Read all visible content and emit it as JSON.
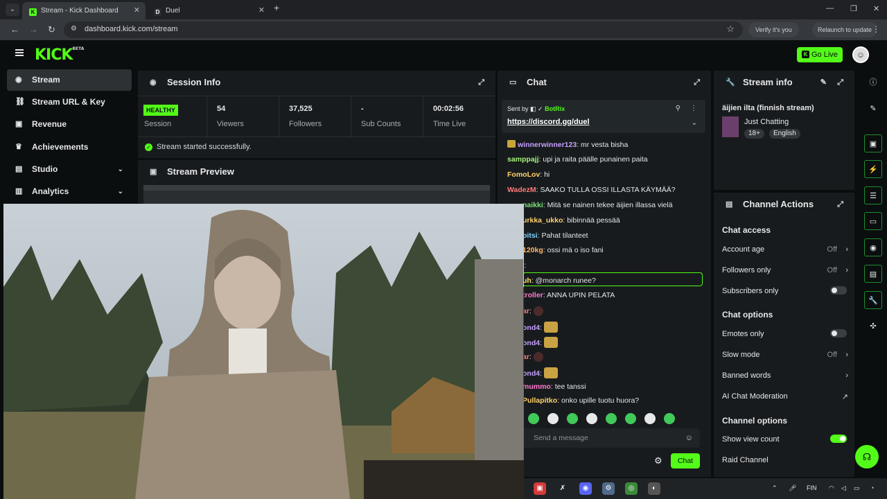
{
  "browser": {
    "tabs": [
      {
        "label": "Stream - Kick Dashboard",
        "favicon": "K"
      },
      {
        "label": "Duel",
        "favicon": "D"
      }
    ],
    "url": "dashboard.kick.com/stream",
    "verify_label": "Verify it's you",
    "relaunch_label": "Relaunch to update"
  },
  "header": {
    "logo": "KICK",
    "logo_badge": "BETA",
    "go_live_label": "Go Live",
    "brand_color": "#53fc18"
  },
  "sidebar": {
    "items": [
      {
        "label": "Stream",
        "icon": "stream-icon",
        "active": true
      },
      {
        "label": "Stream URL & Key",
        "icon": "link-icon"
      },
      {
        "label": "Revenue",
        "icon": "revenue-icon"
      },
      {
        "label": "Achievements",
        "icon": "trophy-icon"
      },
      {
        "label": "Studio",
        "icon": "studio-icon",
        "expandable": true
      },
      {
        "label": "Analytics",
        "icon": "analytics-icon",
        "expandable": true
      }
    ]
  },
  "session": {
    "title": "Session Info",
    "health_badge": "HEALTHY",
    "health_label": "Session",
    "stats": [
      {
        "value": "54",
        "label": "Viewers"
      },
      {
        "value": "37,525",
        "label": "Followers"
      },
      {
        "value": "-",
        "label": "Sub Counts"
      },
      {
        "value": "00:02:56",
        "label": "Time Live"
      }
    ],
    "success_message": "Stream started successfully."
  },
  "preview": {
    "title": "Stream Preview"
  },
  "chat": {
    "title": "Chat",
    "pinned": {
      "sent_by_label": "Sent by",
      "sender": "BotRix",
      "link": "https://discord.gg/duel"
    },
    "messages": [
      {
        "user": "winnerwinner123",
        "color": "#c6a0ff",
        "text": "mr vesta bisha",
        "badge": true
      },
      {
        "user": "samppajj",
        "color": "#a7f07a",
        "text": "upi ja raita päälle punainen paita"
      },
      {
        "user": "FomoLov",
        "color": "#ffd36b",
        "text": "hi"
      },
      {
        "user": "WadezM",
        "color": "#ff7a7a",
        "text": "SAAKO TULLA OSSI ILLASTA KÄYMÄÄ?"
      },
      {
        "user": "naikki",
        "color": "#7ee07e",
        "text": "Mitä se nainen tekee äijien illassa vielä"
      },
      {
        "user": "urkka_ukko",
        "color": "#ffcf6b",
        "text": "bibinnää pessää"
      },
      {
        "user": "pitsi",
        "color": "#7fd3ff",
        "text": "Pahat tilanteet"
      },
      {
        "user": "120kg",
        "color": "#ffb86b",
        "text": "ossi mä o iso fani"
      },
      {
        "user": "",
        "color": "#e6e8ea",
        "text": "l:"
      },
      {
        "user": "uh",
        "color": "#ffe26b",
        "text": "@monarch runee?"
      },
      {
        "user": "troller",
        "color": "#ff7ad1",
        "text": "ANNA UPIN PELATA"
      },
      {
        "user": "ar",
        "color": "#ff7a7a",
        "text": ""
      },
      {
        "user": "ond4",
        "color": "#c6a0ff",
        "text": ""
      },
      {
        "user": "ond4",
        "color": "#c6a0ff",
        "text": ""
      },
      {
        "user": "ar",
        "color": "#ff7a7a",
        "text": ""
      },
      {
        "user": "ond4",
        "color": "#c6a0ff",
        "text": ""
      },
      {
        "user": "mummo",
        "color": "#ff7ad1",
        "text": "tee tanssi"
      },
      {
        "user": "Pullapitko",
        "color": "#ffd36b",
        "text": "onko upille tuotu huora?"
      }
    ],
    "input_placeholder": "Send a message",
    "send_label": "Chat"
  },
  "stream_info": {
    "title": "Stream info",
    "stream_title": "äijien ilta (finnish stream)",
    "category": "Just Chatting",
    "tags": [
      "18+",
      "English"
    ]
  },
  "channel_actions": {
    "title": "Channel Actions",
    "chat_access": {
      "heading": "Chat access",
      "rows": [
        {
          "label": "Account age",
          "value": "Off"
        },
        {
          "label": "Followers only",
          "value": "Off"
        },
        {
          "label": "Subscribers only",
          "toggle": false
        }
      ]
    },
    "chat_options": {
      "heading": "Chat options",
      "rows": [
        {
          "label": "Emotes only",
          "toggle": false
        },
        {
          "label": "Slow mode",
          "value": "Off"
        },
        {
          "label": "Banned words"
        },
        {
          "label": "AI Chat Moderation"
        }
      ]
    },
    "channel_options": {
      "heading": "Channel options",
      "rows": [
        {
          "label": "Show view count",
          "toggle": true
        },
        {
          "label": "Raid Channel"
        }
      ]
    }
  },
  "taskbar": {
    "lang": "FIN"
  }
}
